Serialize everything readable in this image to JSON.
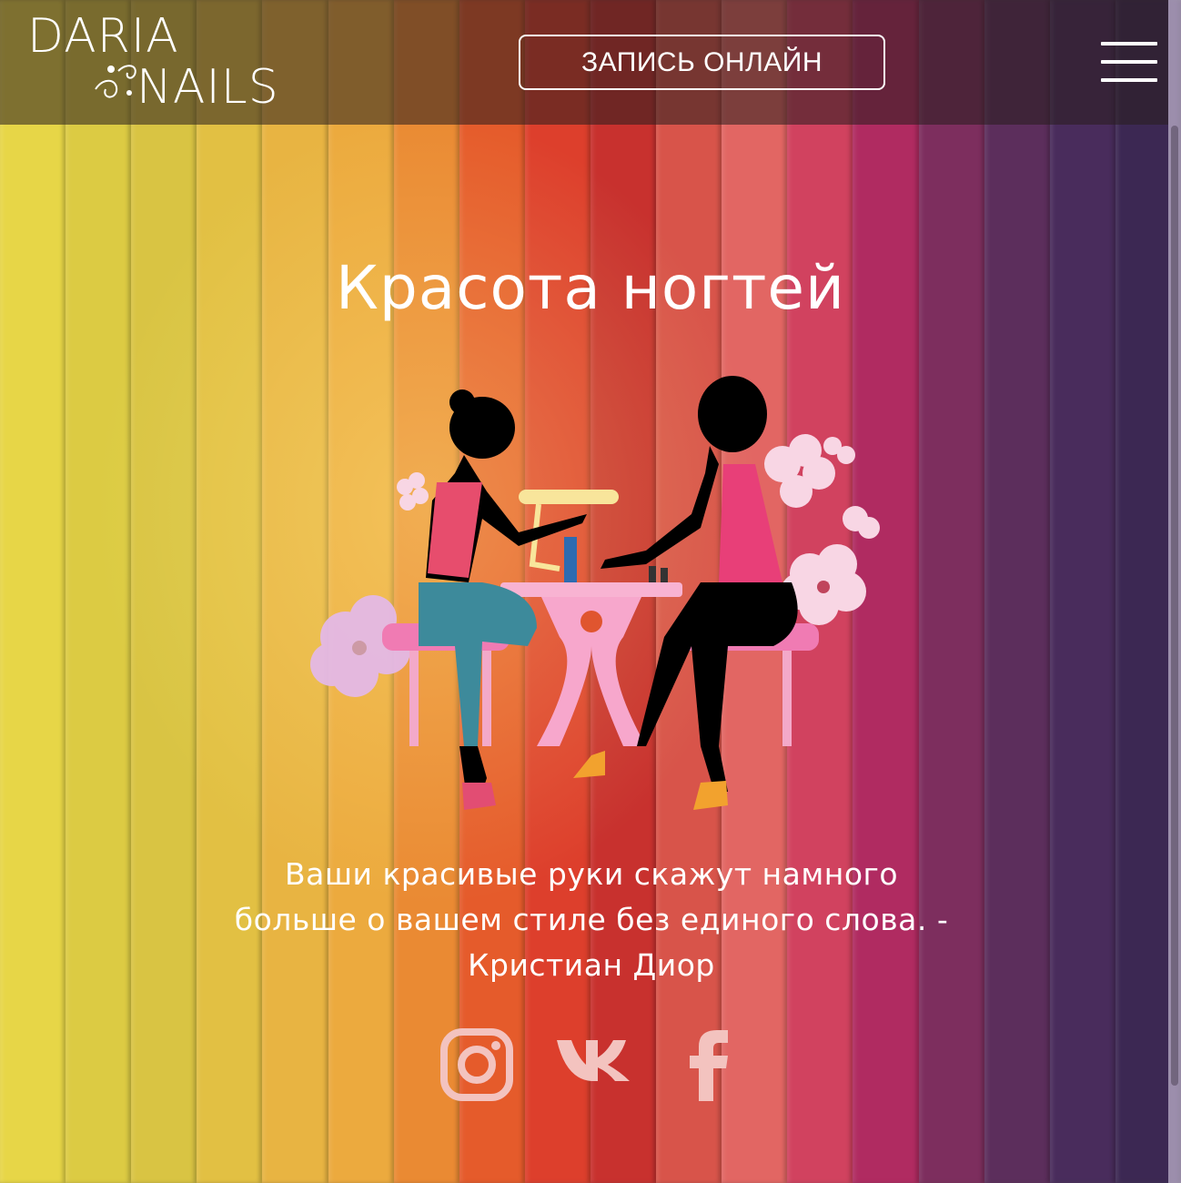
{
  "brand": {
    "line1": "DARIA",
    "line2": "NAILS"
  },
  "header": {
    "book_label": "ЗАПИСЬ ОНЛАЙН",
    "menu_icon": "hamburger-icon"
  },
  "hero": {
    "title": "Красота ногтей",
    "quote": "Ваши красивые руки скажут намного больше о вашем стиле без единого слова. - Кристиан Диор"
  },
  "socials": [
    {
      "name": "instagram-icon"
    },
    {
      "name": "vk-icon"
    },
    {
      "name": "facebook-icon"
    }
  ],
  "colors": {
    "stripes": [
      "#e7d647",
      "#dccb43",
      "#d9c443",
      "#e2c043",
      "#e8b442",
      "#ecaa3e",
      "#ea8a33",
      "#e55b2b",
      "#dd3f2c",
      "#c8312e",
      "#d8544a",
      "#e26663",
      "#d1425f",
      "#b02b61",
      "#7d2e5e",
      "#5c2e5c",
      "#492c5c",
      "#3c2853"
    ],
    "social_icon": "#f3c3bf"
  }
}
